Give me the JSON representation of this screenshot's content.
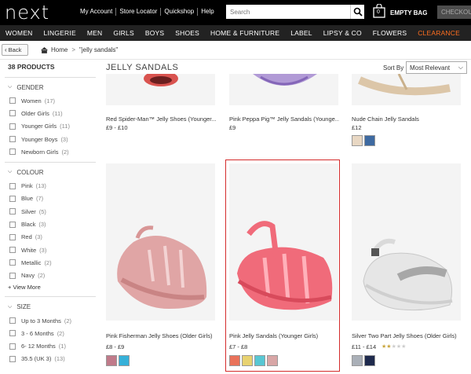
{
  "header": {
    "logo": "next",
    "links": [
      "My Account",
      "Store Locator",
      "Quickshop",
      "Help"
    ],
    "search_placeholder": "Search",
    "bag_count": "0",
    "bag_label": "EMPTY BAG",
    "checkout": "CHECKOUT"
  },
  "nav": [
    "WOMEN",
    "LINGERIE",
    "MEN",
    "GIRLS",
    "BOYS",
    "SHOES",
    "HOME & FURNITURE",
    "LABEL",
    "LIPSY & CO",
    "FLOWERS",
    "CLEARANCE"
  ],
  "breadcrumb": {
    "back": "Back",
    "home": "Home",
    "current": "\"jelly sandals\""
  },
  "sidebar": {
    "product_count": "38 PRODUCTS",
    "gender": {
      "title": "GENDER",
      "options": [
        {
          "label": "Women",
          "count": "(17)"
        },
        {
          "label": "Older Girls",
          "count": "(11)"
        },
        {
          "label": "Younger Girls",
          "count": "(11)"
        },
        {
          "label": "Younger Boys",
          "count": "(3)"
        },
        {
          "label": "Newborn Girls",
          "count": "(2)"
        }
      ]
    },
    "colour": {
      "title": "COLOUR",
      "options": [
        {
          "label": "Pink",
          "count": "(13)"
        },
        {
          "label": "Blue",
          "count": "(7)"
        },
        {
          "label": "Silver",
          "count": "(5)"
        },
        {
          "label": "Black",
          "count": "(3)"
        },
        {
          "label": "Red",
          "count": "(3)"
        },
        {
          "label": "White",
          "count": "(3)"
        },
        {
          "label": "Metallic",
          "count": "(2)"
        },
        {
          "label": "Navy",
          "count": "(2)"
        }
      ],
      "view_more": "+ View More"
    },
    "size": {
      "title": "SIZE",
      "options": [
        {
          "label": "Up to 3 Months",
          "count": "(2)"
        },
        {
          "label": "3 - 6 Months",
          "count": "(2)"
        },
        {
          "label": "6- 12 Months",
          "count": "(1)"
        },
        {
          "label": "35.5 (UK 3)",
          "count": "(13)"
        }
      ]
    }
  },
  "main": {
    "title": "JELLY SANDALS",
    "sort_label": "Sort By",
    "sort_value": "Most Relevant",
    "products": [
      {
        "name": "Red Spider-Man™ Jelly Shoes (Younger...",
        "price": "£9 - £10"
      },
      {
        "name": "Pink Peppa Pig™ Jelly Sandals (Younge...",
        "price": "£9"
      },
      {
        "name": "Nude Chain Jelly Sandals",
        "price": "£12",
        "swatches": [
          "#e8d7c3",
          "#3e6aa1"
        ]
      },
      {
        "name": "Pink Fisherman Jelly Shoes (Older Girls)",
        "price": "£8 - £9",
        "swatches": [
          "#c07a8a",
          "#36b0d8"
        ]
      },
      {
        "name": "Pink Jelly Sandals (Younger Girls)",
        "price": "£7 - £8",
        "swatches": [
          "#e9725a",
          "#e8d270",
          "#58c7d3",
          "#d8a6a6"
        ]
      },
      {
        "name": "Silver Two Part Jelly Shoes (Older Girls)",
        "price": "£11 - £14",
        "swatches": [
          "#aab0b8",
          "#1f2a4d"
        ],
        "rating": 2
      }
    ]
  }
}
